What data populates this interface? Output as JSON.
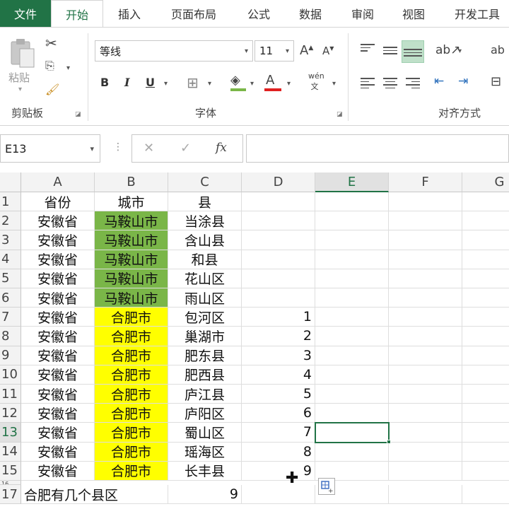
{
  "ribbon_tabs": [
    "文件",
    "开始",
    "插入",
    "页面布局",
    "公式",
    "数据",
    "审阅",
    "视图",
    "开发工具"
  ],
  "active_tab": "开始",
  "clipboard": {
    "paste_label": "粘贴",
    "group_label": "剪贴板"
  },
  "font": {
    "name": "等线",
    "size": "11",
    "group_label": "字体",
    "bold": "B",
    "italic": "I",
    "underline": "U",
    "phonetic": "wén"
  },
  "alignment": {
    "group_label": "对齐方式"
  },
  "formula_bar": {
    "name_box": "E13",
    "fx_label": "fx",
    "cancel": "✕",
    "enter": "✓"
  },
  "columns": [
    "A",
    "B",
    "C",
    "D",
    "E",
    "F",
    "G"
  ],
  "selected_cell": "E13",
  "colors": {
    "excel_green": "#217346",
    "fill_green": "#7ab648",
    "fill_yellow": "#ffff00"
  },
  "rows": [
    {
      "n": "1",
      "a": "省份",
      "b": "城市",
      "c": "县",
      "d": ""
    },
    {
      "n": "2",
      "a": "安徽省",
      "b": "马鞍山市",
      "c": "当涂县",
      "d": ""
    },
    {
      "n": "3",
      "a": "安徽省",
      "b": "马鞍山市",
      "c": "含山县",
      "d": ""
    },
    {
      "n": "4",
      "a": "安徽省",
      "b": "马鞍山市",
      "c": "和县",
      "d": ""
    },
    {
      "n": "5",
      "a": "安徽省",
      "b": "马鞍山市",
      "c": "花山区",
      "d": ""
    },
    {
      "n": "6",
      "a": "安徽省",
      "b": "马鞍山市",
      "c": "雨山区",
      "d": ""
    },
    {
      "n": "7",
      "a": "安徽省",
      "b": "合肥市",
      "c": "包河区",
      "d": "1"
    },
    {
      "n": "8",
      "a": "安徽省",
      "b": "合肥市",
      "c": "巢湖市",
      "d": "2"
    },
    {
      "n": "9",
      "a": "安徽省",
      "b": "合肥市",
      "c": "肥东县",
      "d": "3"
    },
    {
      "n": "10",
      "a": "安徽省",
      "b": "合肥市",
      "c": "肥西县",
      "d": "4"
    },
    {
      "n": "11",
      "a": "安徽省",
      "b": "合肥市",
      "c": "庐江县",
      "d": "5"
    },
    {
      "n": "12",
      "a": "安徽省",
      "b": "合肥市",
      "c": "庐阳区",
      "d": "6"
    },
    {
      "n": "13",
      "a": "安徽省",
      "b": "合肥市",
      "c": "蜀山区",
      "d": "7"
    },
    {
      "n": "14",
      "a": "安徽省",
      "b": "合肥市",
      "c": "瑶海区",
      "d": "8"
    },
    {
      "n": "15",
      "a": "安徽省",
      "b": "合肥市",
      "c": "长丰县",
      "d": "9"
    }
  ],
  "summary_row": {
    "n": "17",
    "label": "合肥有几个县区",
    "value": "9"
  },
  "hidden_row_label": "16"
}
